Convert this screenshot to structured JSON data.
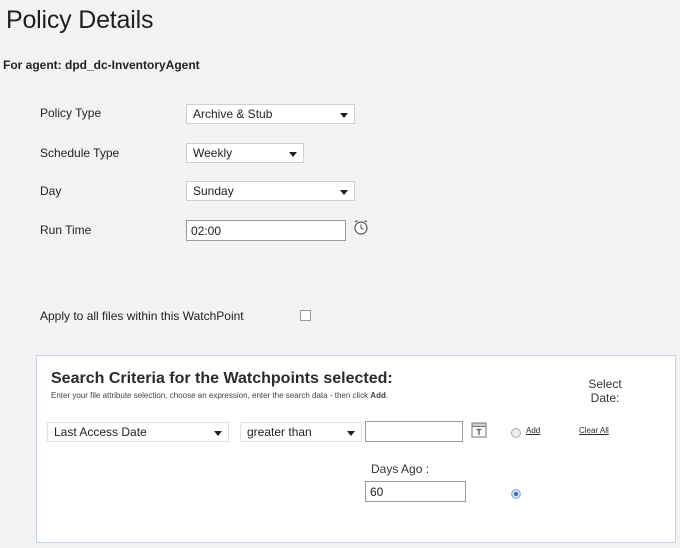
{
  "header": {
    "title": "Policy Details",
    "agent_label": "For agent: dpd_dc-InventoryAgent"
  },
  "form": {
    "policy_type": {
      "label": "Policy Type",
      "value": "Archive & Stub"
    },
    "schedule_type": {
      "label": "Schedule Type",
      "value": "Weekly"
    },
    "day": {
      "label": "Day",
      "value": "Sunday"
    },
    "run_time": {
      "label": "Run Time",
      "value": "02:00",
      "icon": "clock-icon"
    },
    "apply_all": {
      "label": "Apply to all files within this WatchPoint",
      "checked": false
    }
  },
  "search_criteria": {
    "title": "Search Criteria for the Watchpoints selected:",
    "hint_prefix": "Enter your file attribute selection, choose an expression, enter the search data - then click ",
    "hint_action": "Add",
    "hint_suffix": ".",
    "select_date_label": "Select Date:",
    "attribute": "Last Access Date",
    "expression": "greater than",
    "search_value": "",
    "calendar_icon": "calendar-icon",
    "add_link": "Add",
    "clear_all_link": "Clear All",
    "days_ago_label": "Days Ago :",
    "days_ago_value": "60"
  }
}
